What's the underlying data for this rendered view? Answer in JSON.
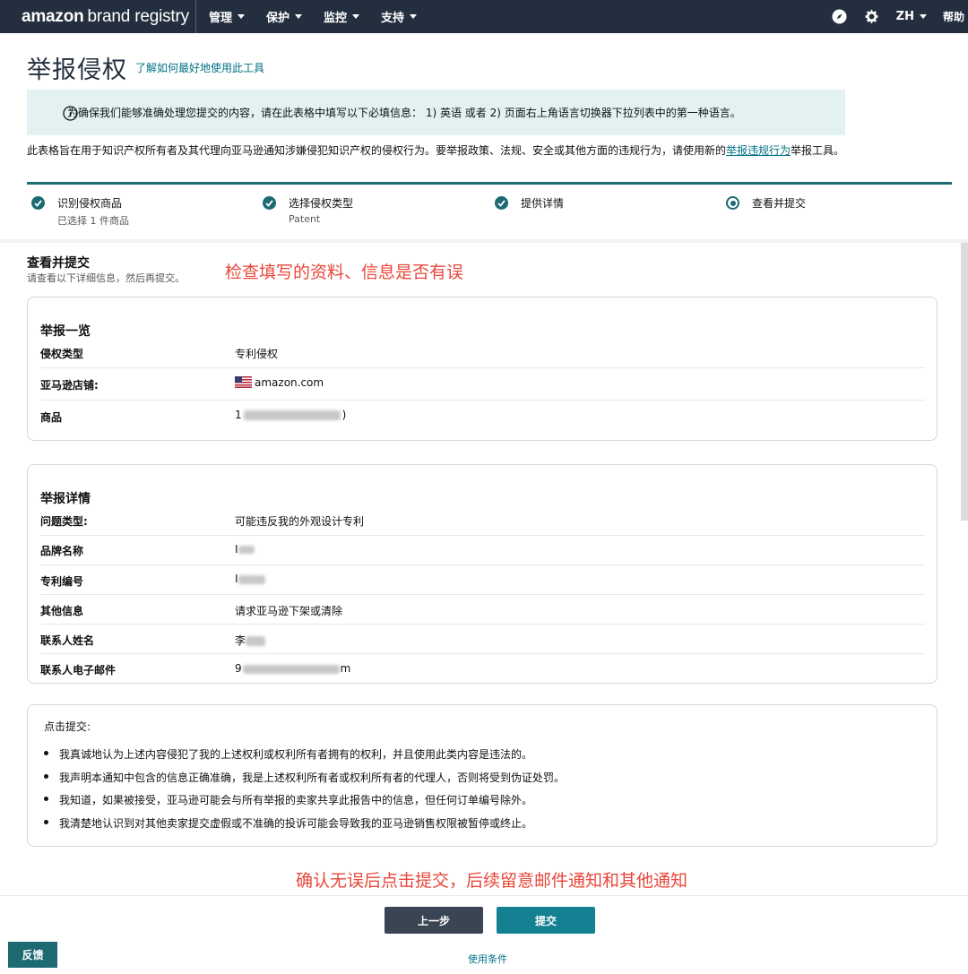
{
  "app": {
    "logo_bold": "amazon",
    "logo_rest": "brand registry",
    "menu": [
      {
        "label": "管理"
      },
      {
        "label": "保护"
      },
      {
        "label": "监控"
      },
      {
        "label": "支持"
      }
    ],
    "lang": "ZH",
    "help": "帮助"
  },
  "header": {
    "title": "举报侵权",
    "learn_link": "了解如何最好地使用此工具"
  },
  "info_banner": {
    "text": "为确保我们能够准确处理您提交的内容，请在此表格中填写以下必填信息： 1) 英语 或者 2) 页面右上角语言切换器下拉列表中的第一种语言。"
  },
  "description": {
    "before": "此表格旨在用于知识产权所有者及其代理向亚马逊通知涉嫌侵犯知识产权的侵权行为。要举报政策、法规、安全或其他方面的违规行为，请使用新的",
    "link": "举报违规行为",
    "after": "举报工具。"
  },
  "steps": [
    {
      "label": "识别侵权商品",
      "sub": "已选择 1 件商品",
      "state": "done"
    },
    {
      "label": "选择侵权类型",
      "sub": "Patent",
      "state": "done"
    },
    {
      "label": "提供详情",
      "sub": "",
      "state": "done"
    },
    {
      "label": "查看并提交",
      "sub": "",
      "state": "current"
    }
  ],
  "review": {
    "title": "查看并提交",
    "subtitle": "请查看以下详细信息，然后再提交。",
    "annotation_top": "检查填写的资料、信息是否有误"
  },
  "summary": {
    "title": "举报一览",
    "rows": [
      {
        "key": "侵权类型",
        "value": "专利侵权"
      },
      {
        "key": "亚马逊店铺:",
        "value": "amazon.com"
      },
      {
        "key": "商品",
        "value_prefix": "1",
        "value_suffix": ")"
      }
    ]
  },
  "details": {
    "title": "举报详情",
    "rows": [
      {
        "key": "问题类型:",
        "value": "可能违反我的外观设计专利"
      },
      {
        "key": "品牌名称",
        "value": "I"
      },
      {
        "key": "专利编号",
        "value": "I"
      },
      {
        "key": "其他信息",
        "value": "请求亚马逊下架或清除"
      },
      {
        "key": "联系人姓名",
        "value": "李"
      },
      {
        "key": "联系人电子邮件",
        "value_prefix": "9",
        "value_suffix": "m"
      }
    ]
  },
  "legal": {
    "label": "点击提交:",
    "items": [
      "我真诚地认为上述内容侵犯了我的上述权利或权利所有者拥有的权利，并且使用此类内容是违法的。",
      "我声明本通知中包含的信息正确准确，我是上述权利所有者或权利所有者的代理人，否则将受到伪证处罚。",
      "我知道，如果被接受，亚马逊可能会与所有举报的卖家共享此报告中的信息，但任何订单编号除外。",
      "我清楚地认识到对其他卖家提交虚假或不准确的投诉可能会导致我的亚马逊销售权限被暂停或终止。"
    ]
  },
  "annotation_bottom": "确认无误后点击提交，后续留意邮件通知和其他通知",
  "buttons": {
    "back": "上一步",
    "submit": "提交"
  },
  "footer": {
    "feedback": "反馈",
    "terms": "使用条件"
  },
  "colors": {
    "nav_bg": "#232f3e",
    "accent": "#1d6a73",
    "submit": "#148193",
    "link": "#007185",
    "annotation": "#e8473a",
    "info_bg": "#e3f1f2"
  },
  "icons": {
    "compass": "compass-icon",
    "settings": "gear-icon",
    "info": "info-icon",
    "check": "check-circle-icon",
    "current": "radio-current-icon",
    "flag": "us-flag-icon"
  }
}
